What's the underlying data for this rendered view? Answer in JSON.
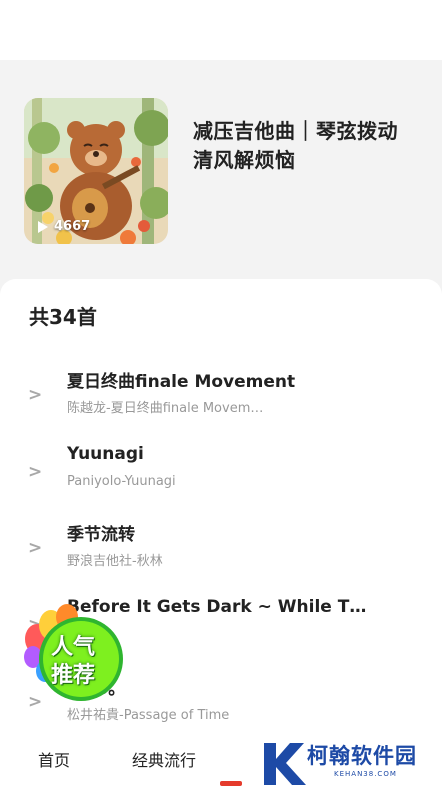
{
  "playlist": {
    "title": "减压吉他曲｜琴弦拨动清风解烦恼",
    "play_count": "4667",
    "cover_icon": "bear-playing-guitar-illustration"
  },
  "track_list": {
    "count_label": "共34首",
    "chevron": ">",
    "tracks": [
      {
        "title": "夏日终曲finale Movement",
        "artist": "陈越龙-夏日终曲finale Movem…"
      },
      {
        "title": "Yuunagi",
        "artist": "Paniyolo-Yuunagi"
      },
      {
        "title": "季节流转",
        "artist": "野浪吉他社-秋林"
      },
      {
        "title": "Before It Gets Dark ~ While T…",
        "artist": ""
      },
      {
        "title": "…flo。",
        "artist": "松井祐貴-Passage of Time"
      }
    ]
  },
  "badge": {
    "line1": "人气",
    "line2": "推荐"
  },
  "bottom_nav": {
    "items": [
      "首页",
      "经典流行"
    ],
    "accent_color": "#e53b2c"
  },
  "watermark": {
    "text": "柯翰软件园",
    "url": "KEHAN38.COM"
  }
}
